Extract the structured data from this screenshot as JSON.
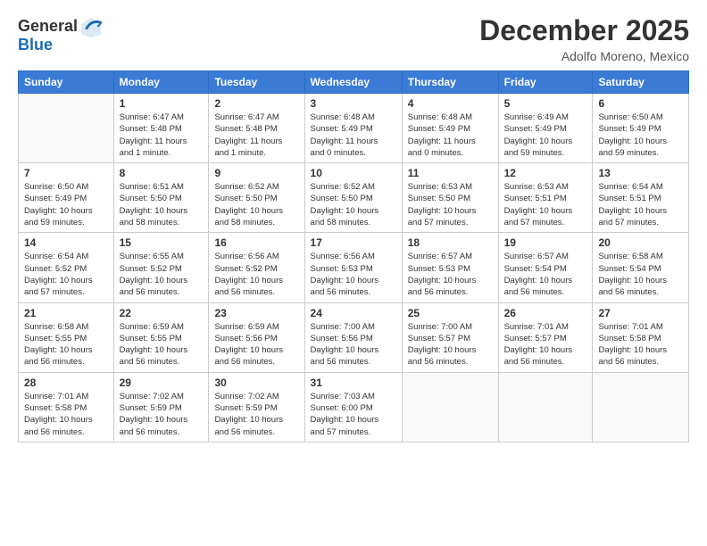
{
  "header": {
    "logo_line1": "General",
    "logo_line2": "Blue",
    "month": "December 2025",
    "location": "Adolfo Moreno, Mexico"
  },
  "days_of_week": [
    "Sunday",
    "Monday",
    "Tuesday",
    "Wednesday",
    "Thursday",
    "Friday",
    "Saturday"
  ],
  "weeks": [
    [
      {
        "num": "",
        "empty": true
      },
      {
        "num": "1",
        "sunrise": "Sunrise: 6:47 AM",
        "sunset": "Sunset: 5:48 PM",
        "daylight": "Daylight: 11 hours and 1 minute."
      },
      {
        "num": "2",
        "sunrise": "Sunrise: 6:47 AM",
        "sunset": "Sunset: 5:48 PM",
        "daylight": "Daylight: 11 hours and 1 minute."
      },
      {
        "num": "3",
        "sunrise": "Sunrise: 6:48 AM",
        "sunset": "Sunset: 5:49 PM",
        "daylight": "Daylight: 11 hours and 0 minutes."
      },
      {
        "num": "4",
        "sunrise": "Sunrise: 6:48 AM",
        "sunset": "Sunset: 5:49 PM",
        "daylight": "Daylight: 11 hours and 0 minutes."
      },
      {
        "num": "5",
        "sunrise": "Sunrise: 6:49 AM",
        "sunset": "Sunset: 5:49 PM",
        "daylight": "Daylight: 10 hours and 59 minutes."
      },
      {
        "num": "6",
        "sunrise": "Sunrise: 6:50 AM",
        "sunset": "Sunset: 5:49 PM",
        "daylight": "Daylight: 10 hours and 59 minutes."
      }
    ],
    [
      {
        "num": "7",
        "sunrise": "Sunrise: 6:50 AM",
        "sunset": "Sunset: 5:49 PM",
        "daylight": "Daylight: 10 hours and 59 minutes."
      },
      {
        "num": "8",
        "sunrise": "Sunrise: 6:51 AM",
        "sunset": "Sunset: 5:50 PM",
        "daylight": "Daylight: 10 hours and 58 minutes."
      },
      {
        "num": "9",
        "sunrise": "Sunrise: 6:52 AM",
        "sunset": "Sunset: 5:50 PM",
        "daylight": "Daylight: 10 hours and 58 minutes."
      },
      {
        "num": "10",
        "sunrise": "Sunrise: 6:52 AM",
        "sunset": "Sunset: 5:50 PM",
        "daylight": "Daylight: 10 hours and 58 minutes."
      },
      {
        "num": "11",
        "sunrise": "Sunrise: 6:53 AM",
        "sunset": "Sunset: 5:50 PM",
        "daylight": "Daylight: 10 hours and 57 minutes."
      },
      {
        "num": "12",
        "sunrise": "Sunrise: 6:53 AM",
        "sunset": "Sunset: 5:51 PM",
        "daylight": "Daylight: 10 hours and 57 minutes."
      },
      {
        "num": "13",
        "sunrise": "Sunrise: 6:54 AM",
        "sunset": "Sunset: 5:51 PM",
        "daylight": "Daylight: 10 hours and 57 minutes."
      }
    ],
    [
      {
        "num": "14",
        "sunrise": "Sunrise: 6:54 AM",
        "sunset": "Sunset: 5:52 PM",
        "daylight": "Daylight: 10 hours and 57 minutes."
      },
      {
        "num": "15",
        "sunrise": "Sunrise: 6:55 AM",
        "sunset": "Sunset: 5:52 PM",
        "daylight": "Daylight: 10 hours and 56 minutes."
      },
      {
        "num": "16",
        "sunrise": "Sunrise: 6:56 AM",
        "sunset": "Sunset: 5:52 PM",
        "daylight": "Daylight: 10 hours and 56 minutes."
      },
      {
        "num": "17",
        "sunrise": "Sunrise: 6:56 AM",
        "sunset": "Sunset: 5:53 PM",
        "daylight": "Daylight: 10 hours and 56 minutes."
      },
      {
        "num": "18",
        "sunrise": "Sunrise: 6:57 AM",
        "sunset": "Sunset: 5:53 PM",
        "daylight": "Daylight: 10 hours and 56 minutes."
      },
      {
        "num": "19",
        "sunrise": "Sunrise: 6:57 AM",
        "sunset": "Sunset: 5:54 PM",
        "daylight": "Daylight: 10 hours and 56 minutes."
      },
      {
        "num": "20",
        "sunrise": "Sunrise: 6:58 AM",
        "sunset": "Sunset: 5:54 PM",
        "daylight": "Daylight: 10 hours and 56 minutes."
      }
    ],
    [
      {
        "num": "21",
        "sunrise": "Sunrise: 6:58 AM",
        "sunset": "Sunset: 5:55 PM",
        "daylight": "Daylight: 10 hours and 56 minutes."
      },
      {
        "num": "22",
        "sunrise": "Sunrise: 6:59 AM",
        "sunset": "Sunset: 5:55 PM",
        "daylight": "Daylight: 10 hours and 56 minutes."
      },
      {
        "num": "23",
        "sunrise": "Sunrise: 6:59 AM",
        "sunset": "Sunset: 5:56 PM",
        "daylight": "Daylight: 10 hours and 56 minutes."
      },
      {
        "num": "24",
        "sunrise": "Sunrise: 7:00 AM",
        "sunset": "Sunset: 5:56 PM",
        "daylight": "Daylight: 10 hours and 56 minutes."
      },
      {
        "num": "25",
        "sunrise": "Sunrise: 7:00 AM",
        "sunset": "Sunset: 5:57 PM",
        "daylight": "Daylight: 10 hours and 56 minutes."
      },
      {
        "num": "26",
        "sunrise": "Sunrise: 7:01 AM",
        "sunset": "Sunset: 5:57 PM",
        "daylight": "Daylight: 10 hours and 56 minutes."
      },
      {
        "num": "27",
        "sunrise": "Sunrise: 7:01 AM",
        "sunset": "Sunset: 5:58 PM",
        "daylight": "Daylight: 10 hours and 56 minutes."
      }
    ],
    [
      {
        "num": "28",
        "sunrise": "Sunrise: 7:01 AM",
        "sunset": "Sunset: 5:58 PM",
        "daylight": "Daylight: 10 hours and 56 minutes."
      },
      {
        "num": "29",
        "sunrise": "Sunrise: 7:02 AM",
        "sunset": "Sunset: 5:59 PM",
        "daylight": "Daylight: 10 hours and 56 minutes."
      },
      {
        "num": "30",
        "sunrise": "Sunrise: 7:02 AM",
        "sunset": "Sunset: 5:59 PM",
        "daylight": "Daylight: 10 hours and 56 minutes."
      },
      {
        "num": "31",
        "sunrise": "Sunrise: 7:03 AM",
        "sunset": "Sunset: 6:00 PM",
        "daylight": "Daylight: 10 hours and 57 minutes."
      },
      {
        "num": "",
        "empty": true
      },
      {
        "num": "",
        "empty": true
      },
      {
        "num": "",
        "empty": true
      }
    ]
  ]
}
